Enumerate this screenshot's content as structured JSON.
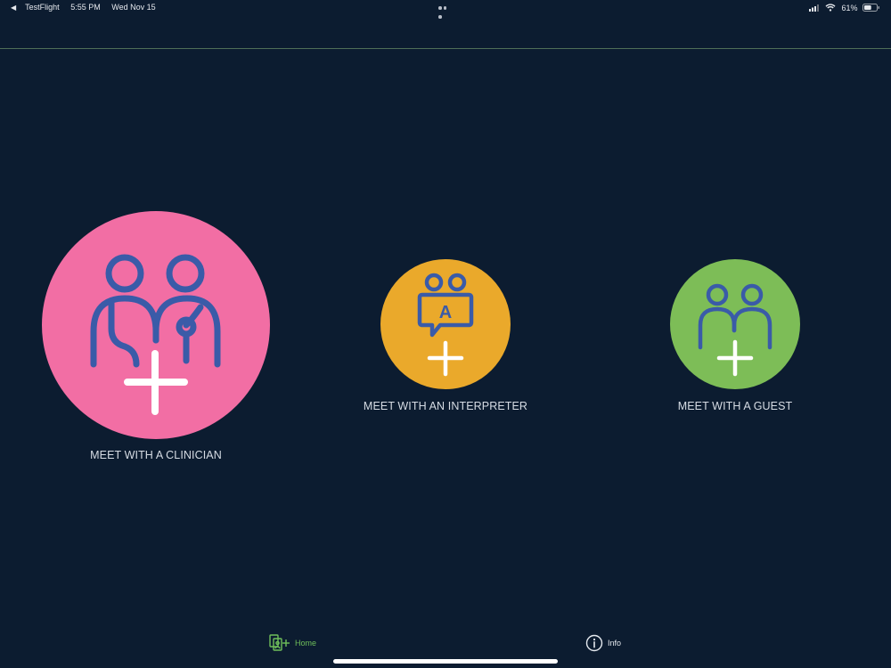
{
  "status_bar": {
    "back_app": "TestFlight",
    "time": "5:55 PM",
    "date": "Wed Nov 15",
    "battery": "61%"
  },
  "options": [
    {
      "label": "MEET WITH A CLINICIAN",
      "color": "#f26ea4",
      "icon": "clinicians-add-icon"
    },
    {
      "label": "MEET WITH AN INTERPRETER",
      "color": "#eaa92b",
      "icon": "interpreter-add-icon",
      "icon_letter": "A"
    },
    {
      "label": "MEET WITH A GUEST",
      "color": "#7dbd57",
      "icon": "guests-add-icon"
    }
  ],
  "tab_bar": {
    "tabs": [
      {
        "label": "Home",
        "icon": "home-meeting-icon",
        "active": true,
        "color": "#6fbf5a"
      },
      {
        "label": "Info",
        "icon": "info-icon",
        "active": false,
        "color": "#e4e8ee"
      }
    ]
  },
  "colors": {
    "background": "#0c1c30",
    "icon_stroke": "#3a5ba8",
    "plus": "#ffffff"
  }
}
